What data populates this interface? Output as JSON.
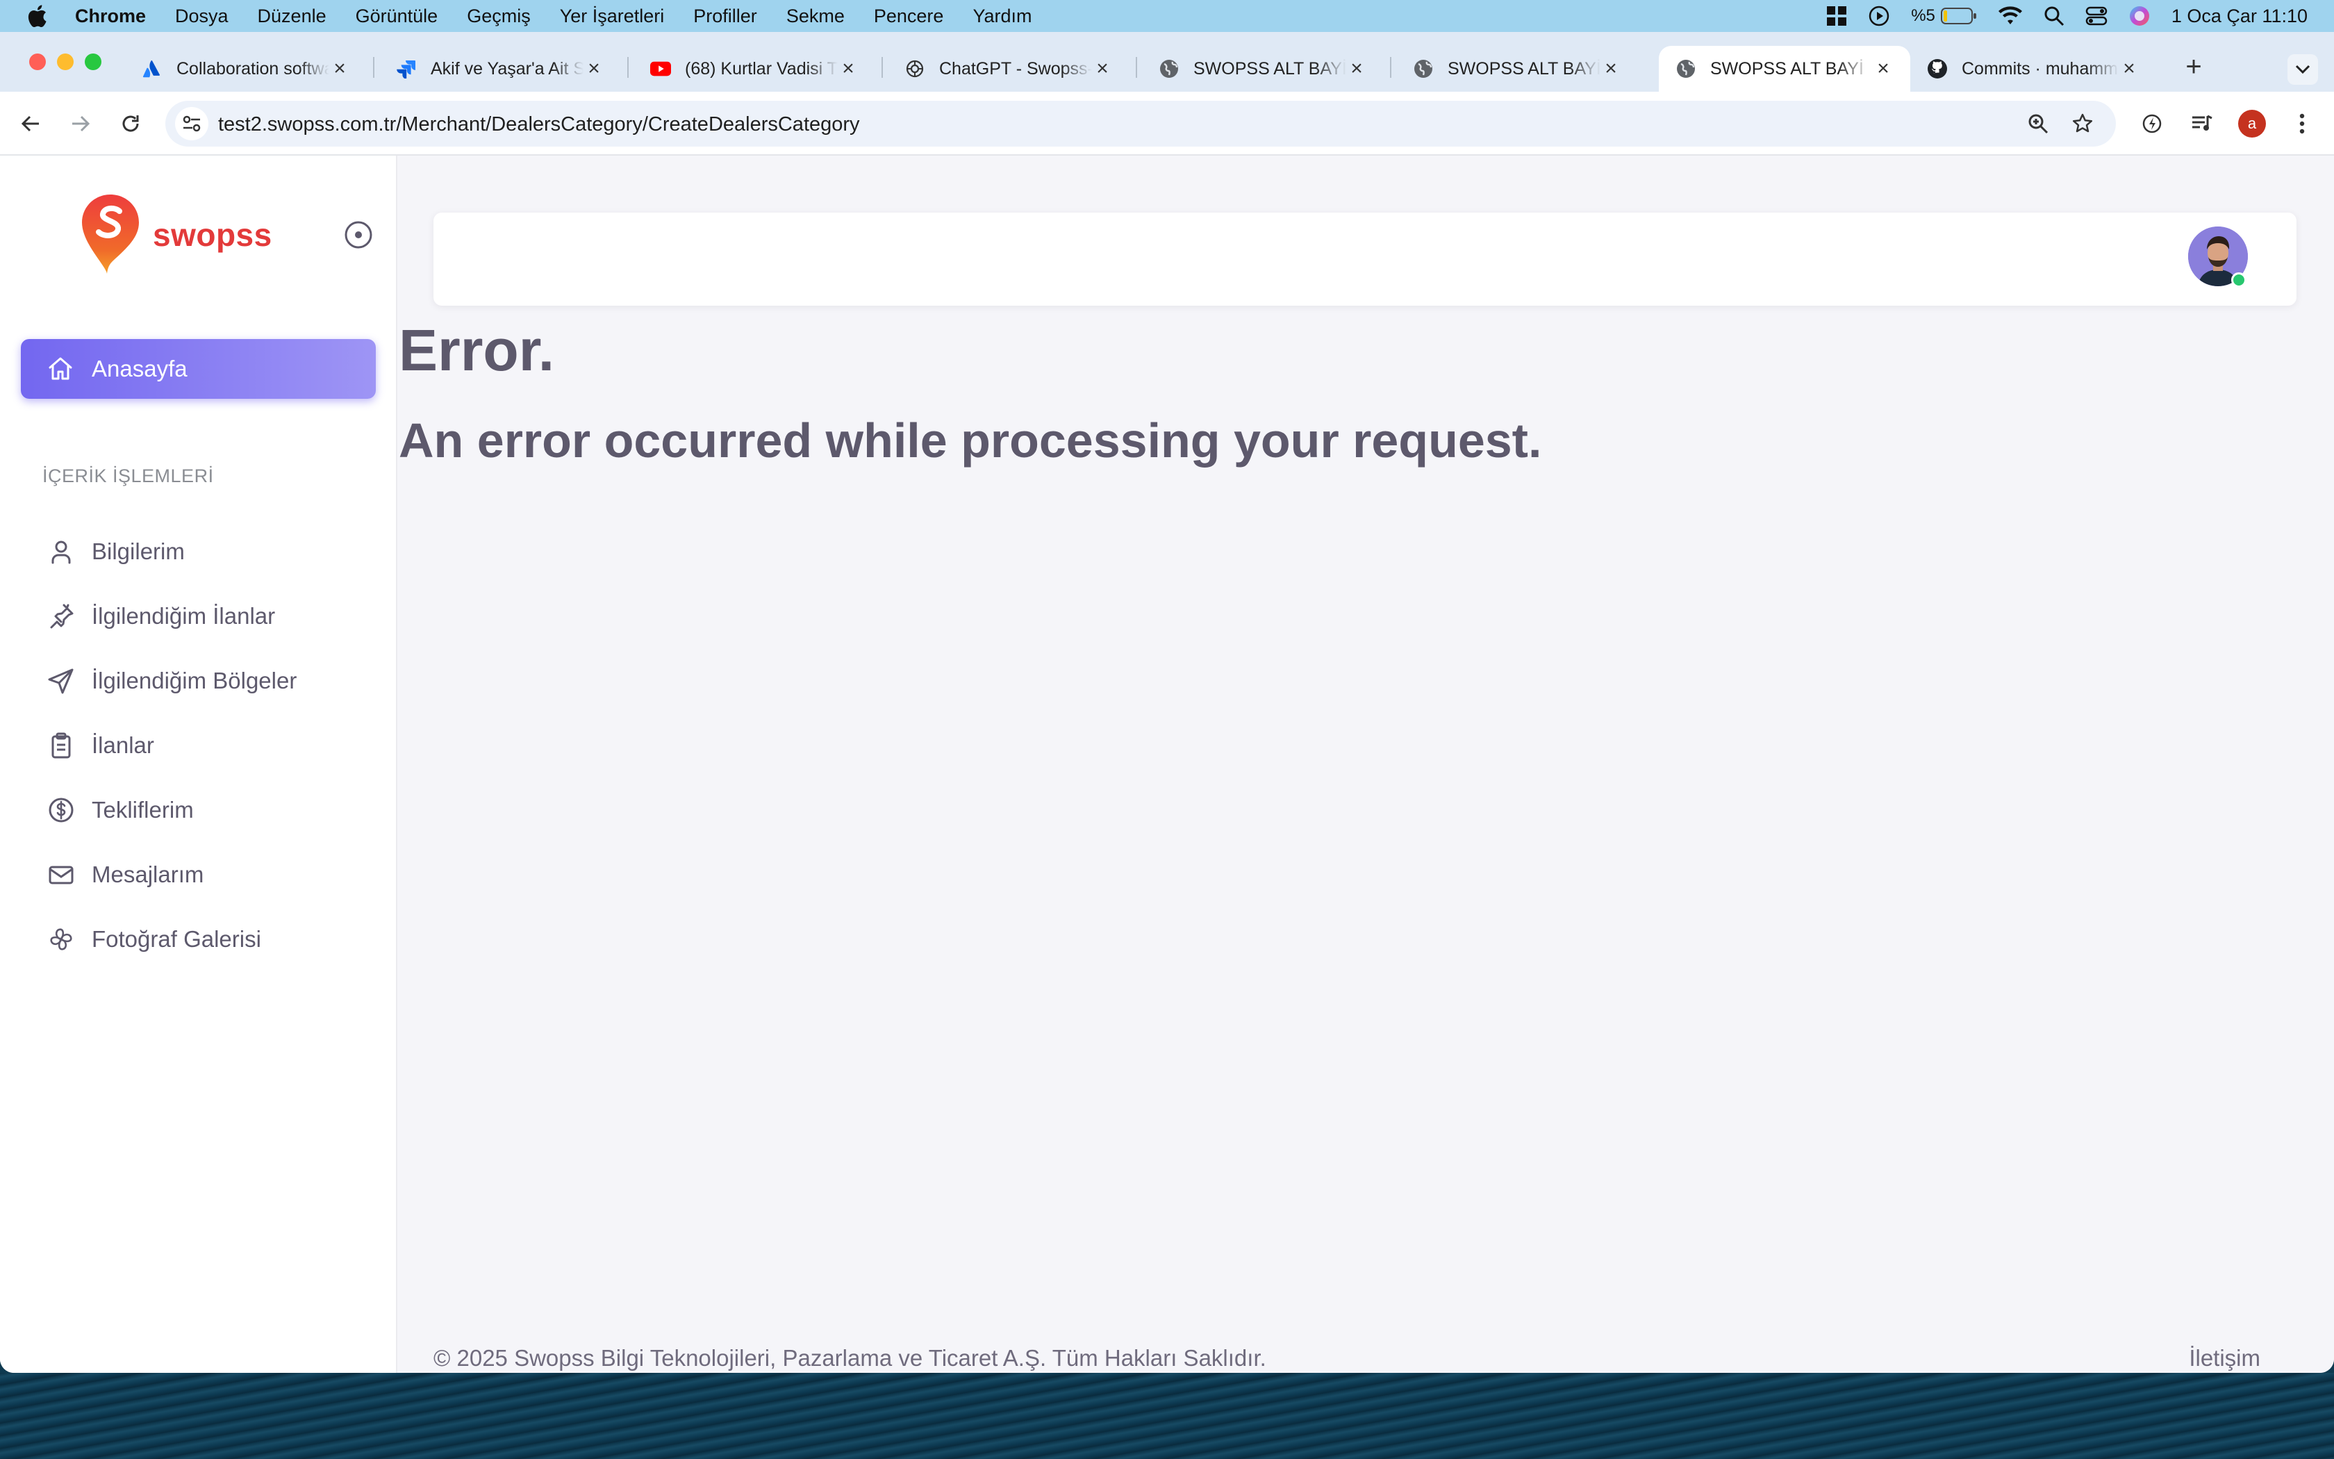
{
  "menubar": {
    "app": "Chrome",
    "items": [
      "Dosya",
      "Düzenle",
      "Görüntüle",
      "Geçmiş",
      "Yer İşaretleri",
      "Profiller",
      "Sekme",
      "Pencere",
      "Yardım"
    ],
    "battery": "%5",
    "clock": "1 Oca Çar  11:10"
  },
  "tabs": [
    {
      "title": "Collaboration software",
      "icon": "atlassian-icon",
      "active": false
    },
    {
      "title": "Akif ve Yaşar'a Ait S",
      "icon": "jira-icon",
      "active": false
    },
    {
      "title": "(68) Kurtlar Vadisi T",
      "icon": "youtube-icon",
      "active": false
    },
    {
      "title": "ChatGPT - Swopss-",
      "icon": "chatgpt-icon",
      "active": false
    },
    {
      "title": "SWOPSS ALT BAYİ |",
      "icon": "globe-icon",
      "active": false
    },
    {
      "title": "SWOPSS ALT BAYİ |",
      "icon": "globe-icon",
      "active": false
    },
    {
      "title": "SWOPSS ALT BAYİ |",
      "icon": "globe-icon",
      "active": true
    },
    {
      "title": "Commits · muhamm",
      "icon": "github-icon",
      "active": false
    }
  ],
  "toolbar": {
    "url": "test2.swopss.com.tr/Merchant/DealersCategory/CreateDealersCategory",
    "profile_initial": "a"
  },
  "sidebar": {
    "brand": "swopss",
    "active_item": {
      "label": "Anasayfa",
      "icon": "home-icon"
    },
    "section_title": "İÇERİK İŞLEMLERİ",
    "items": [
      {
        "label": "Bilgilerim",
        "icon": "user-icon"
      },
      {
        "label": "İlgilendiğim İlanlar",
        "icon": "pin-icon"
      },
      {
        "label": "İlgilendiğim Bölgeler",
        "icon": "send-icon"
      },
      {
        "label": "İlanlar",
        "icon": "clipboard-icon"
      },
      {
        "label": "Tekliflerim",
        "icon": "dollar-icon"
      },
      {
        "label": "Mesajlarım",
        "icon": "mail-icon"
      },
      {
        "label": "Fotoğraf Galerisi",
        "icon": "pinwheel-icon"
      }
    ]
  },
  "main": {
    "error_title": "Error.",
    "error_message": "An error occurred while processing your request."
  },
  "footer": {
    "copyright": "© 2025 Swopss Bilgi Teknolojileri, Pazarlama ve Ticaret A.Ş. Tüm Hakları Saklıdır.",
    "contact": "İletişim"
  },
  "colors": {
    "accent": "#7367f0",
    "brand": "#e33a3a",
    "status_online": "#28c76f"
  }
}
